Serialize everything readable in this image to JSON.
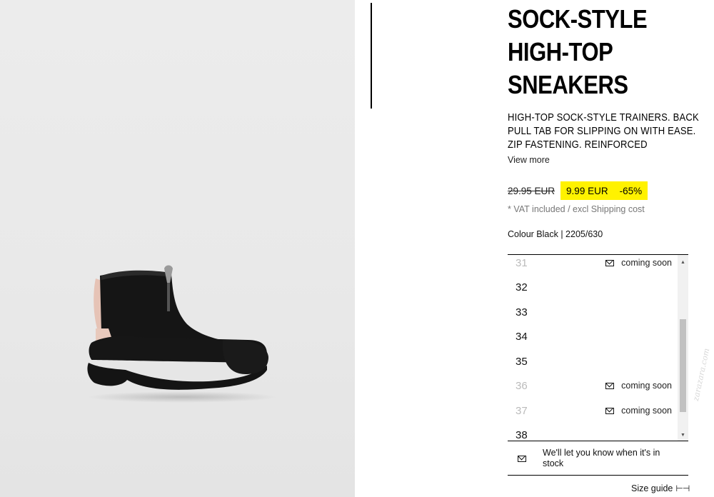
{
  "product": {
    "title": "SOCK-STYLE\nHIGH-TOP\nSNEAKERS",
    "description": "HIGH-TOP SOCK-STYLE TRAINERS. BACK PULL TAB FOR SLIPPING ON WITH EASE. ZIP FASTENING. REINFORCED",
    "view_more": "View more",
    "old_price": "29.95 EUR",
    "sale_price": "9.99 EUR",
    "discount": "-65%",
    "vat_note": "* VAT included / excl Shipping cost",
    "colour": "Colour Black | 2205/630",
    "image_alt_icon": "sneaker-photo"
  },
  "sizes": [
    {
      "size": "31",
      "available": false,
      "status": "coming soon"
    },
    {
      "size": "32",
      "available": true,
      "status": ""
    },
    {
      "size": "33",
      "available": true,
      "status": ""
    },
    {
      "size": "34",
      "available": true,
      "status": ""
    },
    {
      "size": "35",
      "available": true,
      "status": ""
    },
    {
      "size": "36",
      "available": false,
      "status": "coming soon"
    },
    {
      "size": "37",
      "available": false,
      "status": "coming soon"
    },
    {
      "size": "38",
      "available": true,
      "status": ""
    }
  ],
  "scroll": {
    "up_arrow": "▲",
    "down_arrow": "▼"
  },
  "notify": {
    "text": "We'll let you know when it's in stock"
  },
  "size_guide": {
    "label": "Size guide",
    "icon": "⊢⊣"
  },
  "colors": {
    "sale_highlight": "#fff200",
    "divider": "#000000"
  },
  "watermark": "zarazara.com"
}
